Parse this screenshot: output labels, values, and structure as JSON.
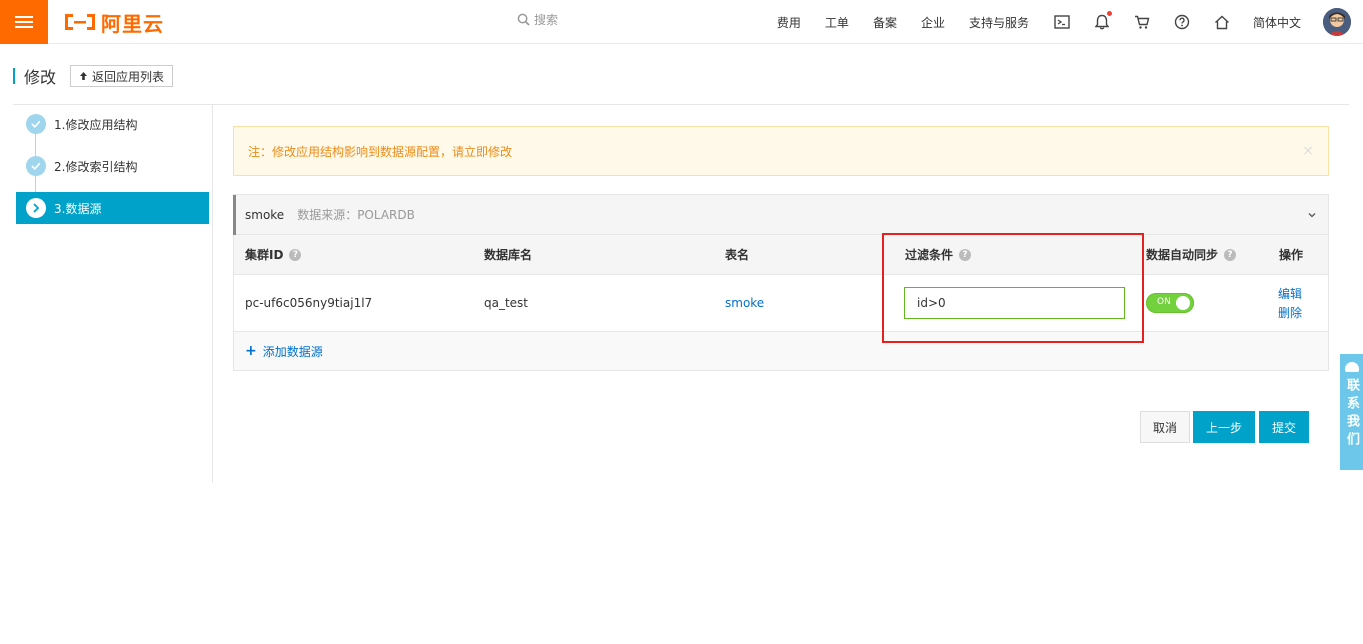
{
  "topbar": {
    "logo_text": "阿里云",
    "search_placeholder": "搜索",
    "nav": [
      "费用",
      "工单",
      "备案",
      "企业",
      "支持与服务"
    ],
    "language": "简体中文"
  },
  "page": {
    "title": "修改",
    "back_label": "返回应用列表"
  },
  "steps": [
    {
      "label": "1.修改应用结构",
      "state": "done"
    },
    {
      "label": "2.修改索引结构",
      "state": "done"
    },
    {
      "label": "3.数据源",
      "state": "active"
    }
  ],
  "notice": {
    "text": "注：修改应用结构影响到数据源配置，请立即修改",
    "close": "×"
  },
  "panel": {
    "name": "smoke",
    "source": "数据来源：POLARDB",
    "columns": [
      "集群ID",
      "数据库名",
      "表名",
      "过滤条件",
      "数据自动同步",
      "操作"
    ],
    "row": {
      "cluster_id": "pc-uf6c056ny9tiaj1l7",
      "db_name": "qa_test",
      "table_name": "smoke",
      "filter": "id>0",
      "sync": "ON",
      "op_edit": "编辑",
      "op_delete": "删除"
    },
    "add_label": "添加数据源"
  },
  "buttons": {
    "cancel": "取消",
    "prev": "上一步",
    "submit": "提交"
  },
  "contact": "联系我们",
  "colors": {
    "brand": "#ff6a00",
    "primary": "#00a2ca",
    "link": "#0070cc",
    "toggle_on": "#73d13d",
    "highlight": "#e61f1f"
  }
}
